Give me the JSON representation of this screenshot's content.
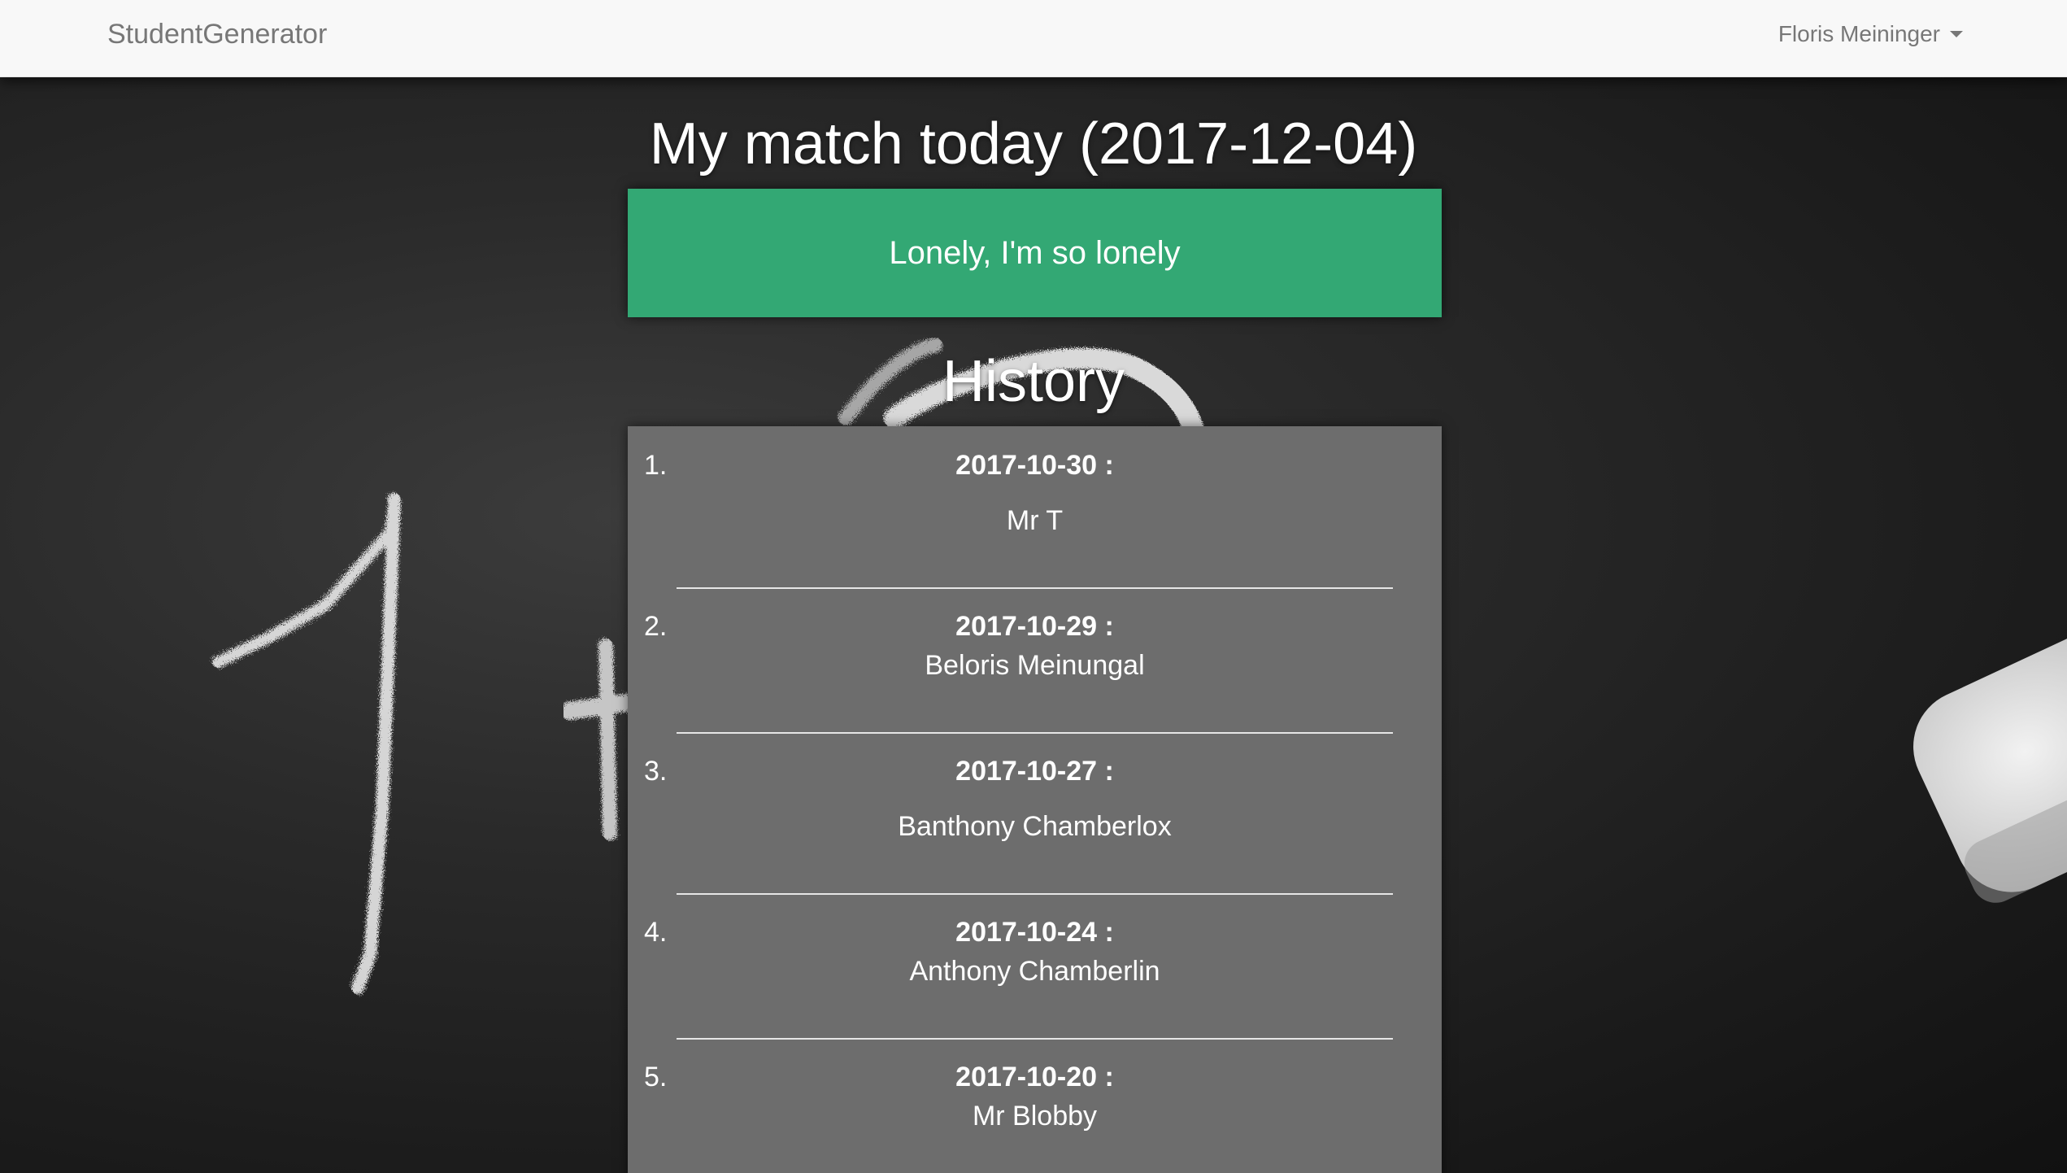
{
  "navbar": {
    "brand": "StudentGenerator",
    "user_name": "Floris Meininger"
  },
  "match": {
    "title": "My match today (2017-12-04)",
    "result": "Lonely, I'm so lonely",
    "card_color": "#33a874"
  },
  "history": {
    "title": "History",
    "items": [
      {
        "number": "1.",
        "date": "2017-10-30 :",
        "name": "Mr T"
      },
      {
        "number": "2.",
        "date": "2017-10-29 :",
        "name": "Beloris Meinungal"
      },
      {
        "number": "3.",
        "date": "2017-10-27 :",
        "name": "Banthony Chamberlox"
      },
      {
        "number": "4.",
        "date": "2017-10-24 :",
        "name": "Anthony Chamberlin"
      },
      {
        "number": "5.",
        "date": "2017-10-20 :",
        "name": "Mr Blobby"
      }
    ]
  }
}
